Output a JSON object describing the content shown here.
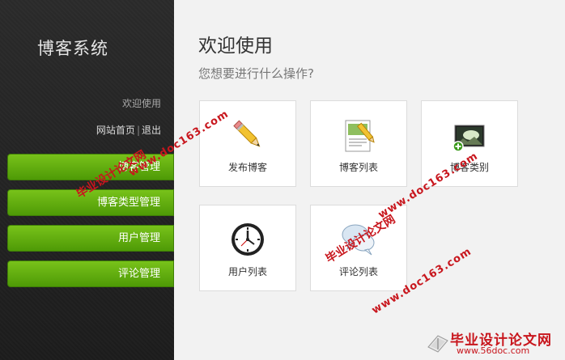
{
  "sidebar": {
    "brand": "博客系统",
    "welcome": "欢迎使用",
    "link_home": "网站首页",
    "link_sep": "|",
    "link_logout": "退出",
    "nav": [
      "博客管理",
      "博客类型管理",
      "用户管理",
      "评论管理"
    ]
  },
  "main": {
    "title": "欢迎使用",
    "subtitle": "您想要进行什么操作?",
    "tiles": [
      {
        "label": "发布博客",
        "icon": "pencil-icon"
      },
      {
        "label": "博客列表",
        "icon": "document-list-icon"
      },
      {
        "label": "博客类别",
        "icon": "image-add-icon"
      },
      {
        "label": "用户列表",
        "icon": "clock-icon"
      },
      {
        "label": "评论列表",
        "icon": "speech-bubbles-icon"
      }
    ]
  },
  "watermark": {
    "cn": "毕业设计论文网",
    "url": "www.doc163.com",
    "logo_text": "毕业设计论文网",
    "logo_url": "www.56doc.com",
    "color": "#c8161d"
  },
  "colors": {
    "nav_green": "#5aa80a",
    "sidebar_bg": "#222222",
    "main_bg": "#f2f2f2"
  }
}
